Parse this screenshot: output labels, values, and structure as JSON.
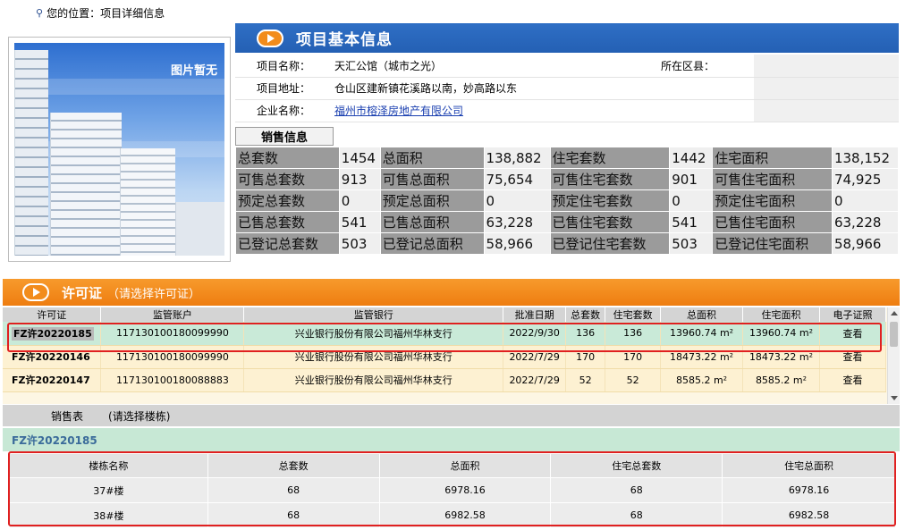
{
  "breadcrumb": {
    "text": "您的位置：项目详细信息"
  },
  "photo": {
    "caption": "图片暂无"
  },
  "info": {
    "title": "项目基本信息",
    "project_name_label": "项目名称：",
    "project_name": "天汇公馆（城市之光）",
    "district_label": "所在区县：",
    "district": "",
    "address_label": "项目地址：",
    "address": "仓山区建新镇花溪路以南，妙高路以东",
    "company_label": "企业名称：",
    "company": "福州市榕泽房地产有限公司"
  },
  "sales": {
    "tab_label": "销售信息",
    "rows": [
      [
        "总套数",
        "1454",
        "总面积",
        "138,882",
        "住宅套数",
        "1442",
        "住宅面积",
        "138,152"
      ],
      [
        "可售总套数",
        "913",
        "可售总面积",
        "75,654",
        "可售住宅套数",
        "901",
        "可售住宅面积",
        "74,925"
      ],
      [
        "预定总套数",
        "0",
        "预定总面积",
        "0",
        "预定住宅套数",
        "0",
        "预定住宅面积",
        "0"
      ],
      [
        "已售总套数",
        "541",
        "已售总面积",
        "63,228",
        "已售住宅套数",
        "541",
        "已售住宅面积",
        "63,228"
      ],
      [
        "已登记总套数",
        "503",
        "已登记总面积",
        "58,966",
        "已登记住宅套数",
        "503",
        "已登记住宅面积",
        "58,966"
      ]
    ]
  },
  "permit": {
    "title": "许可证",
    "subtitle": "（请选择许可证）",
    "columns": [
      "许可证",
      "监管账户",
      "监管银行",
      "批准日期",
      "总套数",
      "住宅套数",
      "总面积",
      "住宅面积",
      "电子证照"
    ],
    "rows": [
      {
        "code": "FZ许20220185",
        "account": "117130100180099990",
        "bank": "兴业银行股份有限公司福州华林支行",
        "date": "2022/9/30",
        "total": "136",
        "residential": "136",
        "area": "13960.74 m²",
        "res_area": "13960.74 m²",
        "link": "查看"
      },
      {
        "code": "FZ许20220146",
        "account": "117130100180099990",
        "bank": "兴业银行股份有限公司福州华林支行",
        "date": "2022/7/29",
        "total": "170",
        "residential": "170",
        "area": "18473.22 m²",
        "res_area": "18473.22 m²",
        "link": "查看"
      },
      {
        "code": "FZ许20220147",
        "account": "117130100180088883",
        "bank": "兴业银行股份有限公司福州华林支行",
        "date": "2022/7/29",
        "total": "52",
        "residential": "52",
        "area": "8585.2 m²",
        "res_area": "8585.2 m²",
        "link": "查看"
      }
    ]
  },
  "sales_table": {
    "label": "销售表",
    "hint": "(请选择楼栋)",
    "current_permit": "FZ许20220185",
    "columns": [
      "楼栋名称",
      "总套数",
      "总面积",
      "住宅总套数",
      "住宅总面积"
    ],
    "rows": [
      [
        "37#楼",
        "68",
        "6978.16",
        "68",
        "6978.16"
      ],
      [
        "38#楼",
        "68",
        "6982.58",
        "68",
        "6982.58"
      ]
    ]
  }
}
